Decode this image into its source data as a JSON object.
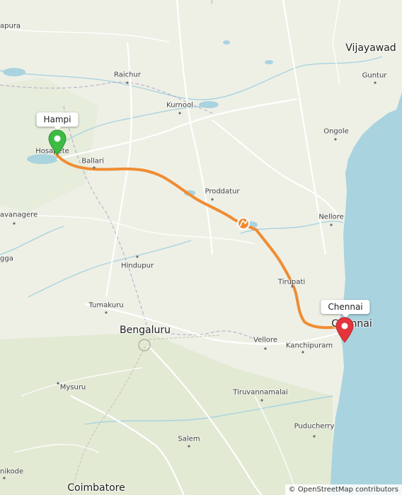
{
  "map": {
    "route_color": "#f08c33",
    "water_color": "#a9d3df",
    "land_color": "#eef0e6"
  },
  "markers": {
    "start": {
      "label": "Hampi",
      "color": "#3dbb43"
    },
    "end": {
      "label": "Chennai",
      "color": "#e5343c"
    },
    "via_icon": "route-waypoint-icon"
  },
  "places": [
    {
      "name": "Vijayawad"
    },
    {
      "name": "Guntur"
    },
    {
      "name": "Raichur"
    },
    {
      "name": "Kurnool"
    },
    {
      "name": "Ongole"
    },
    {
      "name": "Hosapete"
    },
    {
      "name": "Ballari"
    },
    {
      "name": "Nellore"
    },
    {
      "name": "Proddatur"
    },
    {
      "name": "avanagere"
    },
    {
      "name": "gga"
    },
    {
      "name": "Hindupur"
    },
    {
      "name": "Tirupati"
    },
    {
      "name": "Tumakuru"
    },
    {
      "name": "Bengaluru"
    },
    {
      "name": "Chennai"
    },
    {
      "name": "Vellore"
    },
    {
      "name": "Kanchipuram"
    },
    {
      "name": "Mysuru"
    },
    {
      "name": "Tiruvannamalai"
    },
    {
      "name": "Puducherry"
    },
    {
      "name": "Salem"
    },
    {
      "name": "nikode"
    },
    {
      "name": "Coimbatore"
    },
    {
      "name": "apura"
    }
  ],
  "attribution": "© OpenStreetMap contributors"
}
